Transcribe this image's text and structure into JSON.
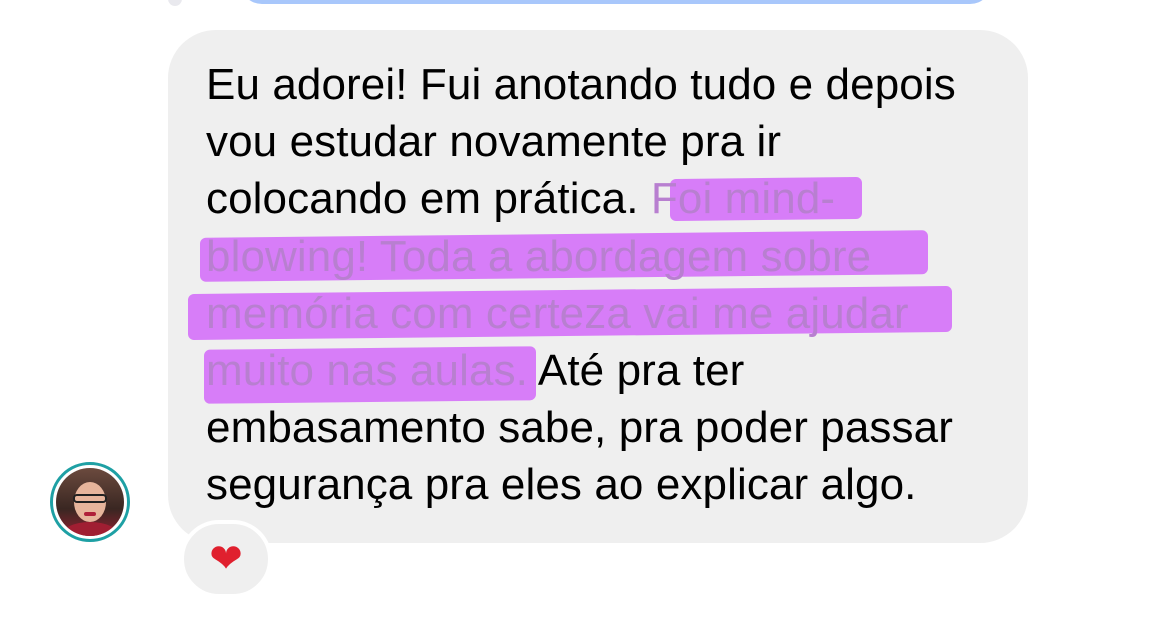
{
  "message": {
    "lines": [
      {
        "before": "Eu adorei! Fui anotando tudo e depois",
        "highlight": "",
        "after": ""
      },
      {
        "before": "vou estudar novamente pra ir",
        "highlight": "",
        "after": ""
      },
      {
        "before": "colocando em prática. ",
        "highlight": "Foi mind-",
        "after": ""
      },
      {
        "before": "",
        "highlight": "blowing! Toda a abordagem sobre",
        "after": ""
      },
      {
        "before": "",
        "highlight": "memória com certeza vai me ajudar",
        "after": ""
      },
      {
        "before": "",
        "highlight": "muito nas aulas.",
        "after": " Até pra ter"
      },
      {
        "before": "embasamento sabe, pra poder passar",
        "highlight": "",
        "after": ""
      },
      {
        "before": "segurança pra eles ao explicar algo.",
        "highlight": "",
        "after": ""
      }
    ],
    "highlight_color": "#d264fa"
  },
  "reaction": {
    "icon": "heart-icon",
    "glyph": "❤",
    "color": "#e0202e"
  },
  "sender": {
    "avatar_icon": "avatar",
    "ring_color": "#1ea0a4"
  },
  "colors": {
    "bubble": "#efefef",
    "previous_bubble": "#a8c7fb"
  }
}
